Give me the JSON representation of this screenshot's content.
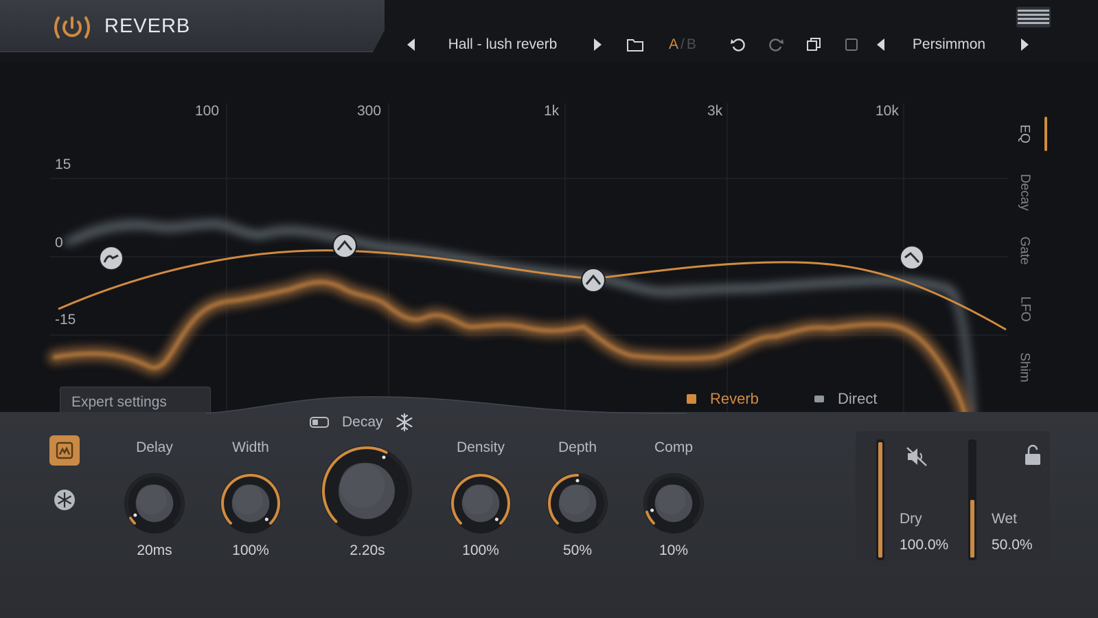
{
  "app": {
    "title": "REVERB"
  },
  "colors": {
    "accent": "#d18b3f",
    "direct": "#5f676c",
    "background": "#121317",
    "panel": "#2f3237"
  },
  "toolbar": {
    "preset_name": "Hall - lush reverb",
    "ab_a": "A",
    "ab_sep": "/",
    "ab_b": "B",
    "theme_name": "Persimmon",
    "icons": [
      "prev-preset-icon",
      "next-preset-icon",
      "folder-icon",
      "undo-icon",
      "redo-icon",
      "copy-icon",
      "paste-icon",
      "prev-theme-icon",
      "next-theme-icon",
      "menu-icon"
    ]
  },
  "graph": {
    "freq_labels": [
      "100",
      "300",
      "1k",
      "3k",
      "10k"
    ],
    "db_labels": [
      "15",
      "0",
      "-15"
    ],
    "side_tabs": [
      "EQ",
      "Decay",
      "Gate",
      "LFO",
      "Shim"
    ],
    "active_tab": "EQ",
    "expert_settings": "Expert settings",
    "legend": [
      {
        "label": "Reverb",
        "color": "#d18b3f"
      },
      {
        "label": "Direct",
        "color": "#8e979c"
      }
    ]
  },
  "controls": {
    "decay_label": "Decay",
    "knobs": [
      {
        "label": "Delay",
        "value": "20ms",
        "amount": 0.05
      },
      {
        "label": "Width",
        "value": "100%",
        "amount": 1.0
      },
      {
        "label": "Decay",
        "value": "2.20s",
        "amount": 0.6
      },
      {
        "label": "Density",
        "value": "100%",
        "amount": 1.0
      },
      {
        "label": "Depth",
        "value": "50%",
        "amount": 0.5
      },
      {
        "label": "Comp",
        "value": "10%",
        "amount": 0.1
      }
    ]
  },
  "mix": {
    "dry_label": "Dry",
    "dry_value": "100.0%",
    "dry_level": 1.0,
    "wet_label": "Wet",
    "wet_value": "50.0%",
    "wet_level": 0.5
  }
}
